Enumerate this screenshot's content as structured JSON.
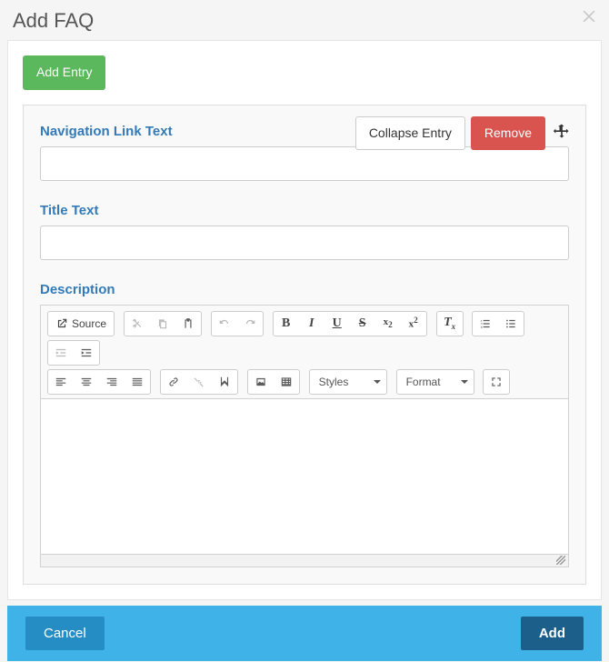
{
  "modal": {
    "title": "Add FAQ",
    "add_entry_button": "Add Entry"
  },
  "entry": {
    "collapse_button": "Collapse Entry",
    "remove_button": "Remove",
    "nav_link_label": "Navigation Link Text",
    "nav_link_value": "",
    "title_label": "Title Text",
    "title_value": "",
    "description_label": "Description"
  },
  "editor": {
    "source_label": "Source",
    "styles_label": "Styles",
    "format_label": "Format"
  },
  "footer": {
    "cancel": "Cancel",
    "add": "Add"
  }
}
